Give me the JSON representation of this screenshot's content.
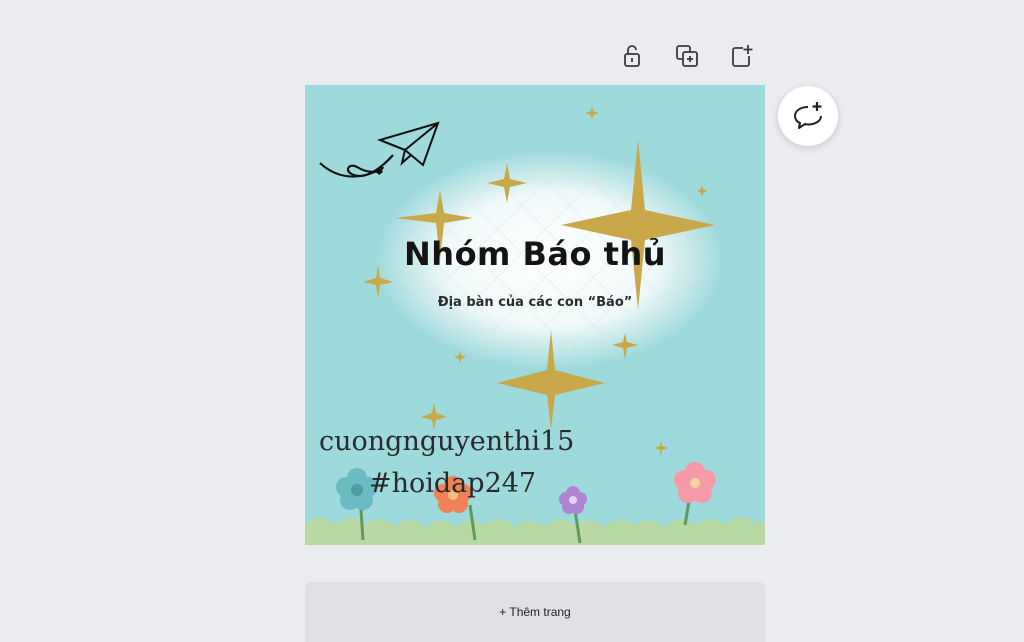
{
  "toolbar": {
    "items": [
      {
        "icon": "unlock-icon",
        "tooltip": ""
      },
      {
        "icon": "duplicate-page-icon",
        "tooltip": ""
      },
      {
        "icon": "add-page-icon",
        "tooltip": ""
      }
    ]
  },
  "design": {
    "title": "Nhóm Báo thủ",
    "subtitle": "Địa bàn của các con “Báo”",
    "watermark_line1": "cuongnguyenthi15",
    "watermark_line2": "#hoidap247",
    "background_color": "#9ed9db"
  },
  "comment_button": {
    "icon": "add-comment-icon"
  },
  "add_page": {
    "label": "+ Thêm trang"
  }
}
